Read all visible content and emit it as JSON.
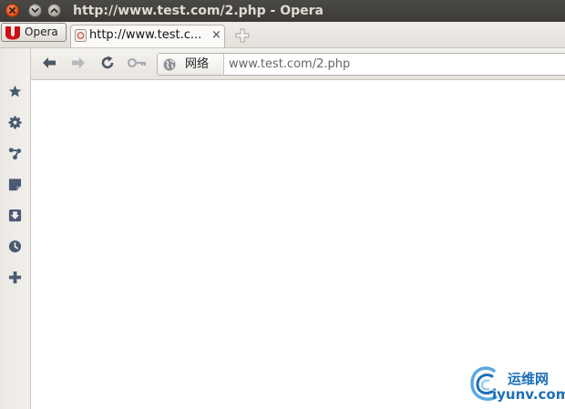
{
  "window": {
    "title": "http://www.test.com/2.php - Opera",
    "buttons": [
      "close-icon",
      "minimize-icon",
      "maximize-icon"
    ]
  },
  "menu": {
    "opera_label": "Opera"
  },
  "tabs": [
    {
      "title": "http://www.test.c...",
      "active": true,
      "close": "×"
    }
  ],
  "toolbar": {
    "buttons": [
      "back-icon",
      "forward-icon",
      "reload-icon",
      "wand-icon"
    ],
    "address": {
      "badge_label": "网络",
      "url": "www.test.com/2.php"
    }
  },
  "sidebar": {
    "items": [
      "bookmarks-icon",
      "settings-icon",
      "unite-icon",
      "notes-icon",
      "downloads-icon",
      "history-icon",
      "add-panel-icon"
    ]
  },
  "watermark": {
    "cn": "运维网",
    "en": "iyunv.com"
  },
  "colors": {
    "titlebar": "#3c3b37",
    "close_button": "#e2541d",
    "opera_red": "#cc0f16",
    "side_icon": "#4a5a72",
    "watermark": "#1d6fb8"
  }
}
